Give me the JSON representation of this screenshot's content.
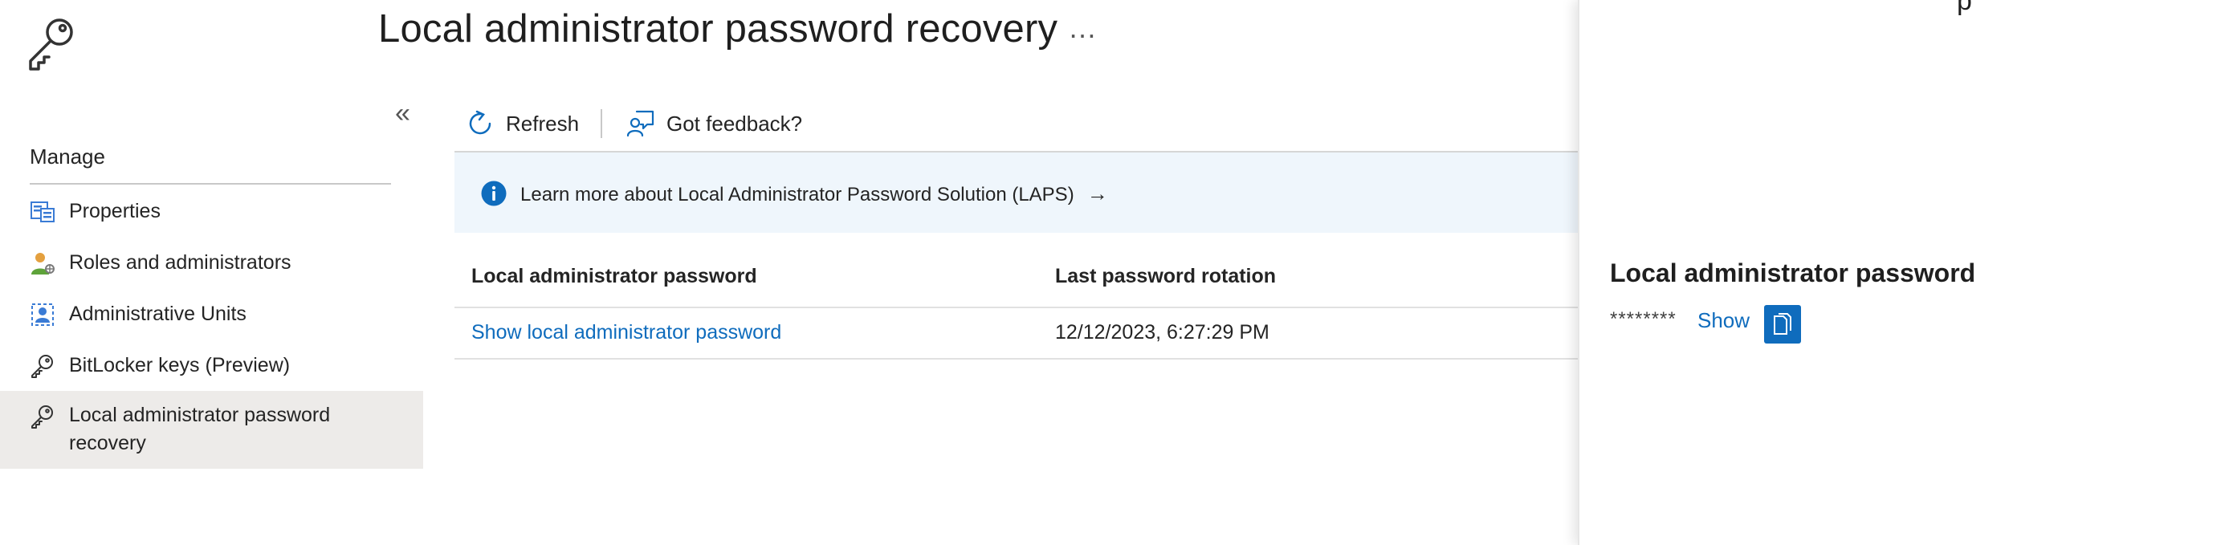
{
  "header": {
    "title": "Local administrator password recovery",
    "more_label": "…"
  },
  "sidebar": {
    "collapse_label": "«",
    "section_title": "Manage",
    "items": [
      {
        "label": "Properties",
        "icon": "properties-icon"
      },
      {
        "label": "Roles and administrators",
        "icon": "roles-icon"
      },
      {
        "label": "Administrative Units",
        "icon": "admin-units-icon"
      },
      {
        "label": "BitLocker keys (Preview)",
        "icon": "key-icon"
      },
      {
        "label_line1": "Local administrator password",
        "label_line2": "recovery",
        "icon": "key-icon",
        "active": true
      }
    ]
  },
  "toolbar": {
    "refresh_label": "Refresh",
    "feedback_label": "Got feedback?"
  },
  "banner": {
    "text": "Learn more about Local Administrator Password Solution (LAPS)",
    "arrow": "→"
  },
  "table": {
    "headers": [
      "Local administrator password",
      "Last password rotation"
    ],
    "rows": [
      {
        "password_link": "Show local administrator password",
        "last_rotation": "12/12/2023, 6:27:29 PM"
      }
    ]
  },
  "panel": {
    "title_fragment": "p",
    "heading": "Local administrator password",
    "masked_password": "********",
    "show_label": "Show"
  },
  "colors": {
    "accent": "#0f6cbd",
    "banner_bg": "#eff6fc",
    "active_nav_bg": "#edebe9"
  }
}
